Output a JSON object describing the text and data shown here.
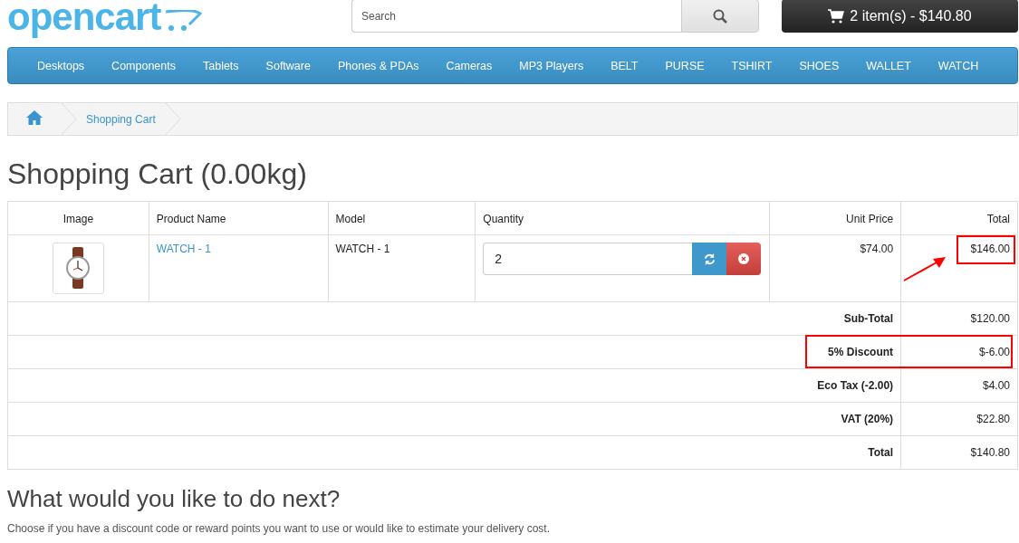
{
  "header": {
    "logo": "opencart",
    "search": {
      "placeholder": "Search"
    },
    "cart_button": "2 item(s) - $140.80"
  },
  "menu": [
    "Desktops",
    "Components",
    "Tablets",
    "Software",
    "Phones & PDAs",
    "Cameras",
    "MP3 Players",
    "BELT",
    "PURSE",
    "TSHIRT",
    "SHOES",
    "WALLET",
    "WATCH"
  ],
  "breadcrumb": [
    "Shopping Cart"
  ],
  "title": "Shopping Cart (0.00kg)",
  "table": {
    "columns": [
      "Image",
      "Product Name",
      "Model",
      "Quantity",
      "Unit Price",
      "Total"
    ],
    "rows": [
      {
        "name": "WATCH - 1",
        "model": "WATCH - 1",
        "quantity": "2",
        "unit_price": "$74.00",
        "total": "$146.00",
        "highlighted": true
      }
    ]
  },
  "totals": [
    {
      "label": "Sub-Total",
      "value": "$120.00",
      "highlighted": false
    },
    {
      "label": "5% Discount",
      "value": "$-6.00",
      "highlighted": true
    },
    {
      "label": "Eco Tax (-2.00)",
      "value": "$4.00",
      "highlighted": false
    },
    {
      "label": "VAT (20%)",
      "value": "$22.80",
      "highlighted": false
    },
    {
      "label": "Total",
      "value": "$140.80",
      "highlighted": false
    }
  ],
  "next": {
    "heading": "What would you like to do next?",
    "text": "Choose if you have a discount code or reward points you want to use or would like to estimate your delivery cost."
  }
}
